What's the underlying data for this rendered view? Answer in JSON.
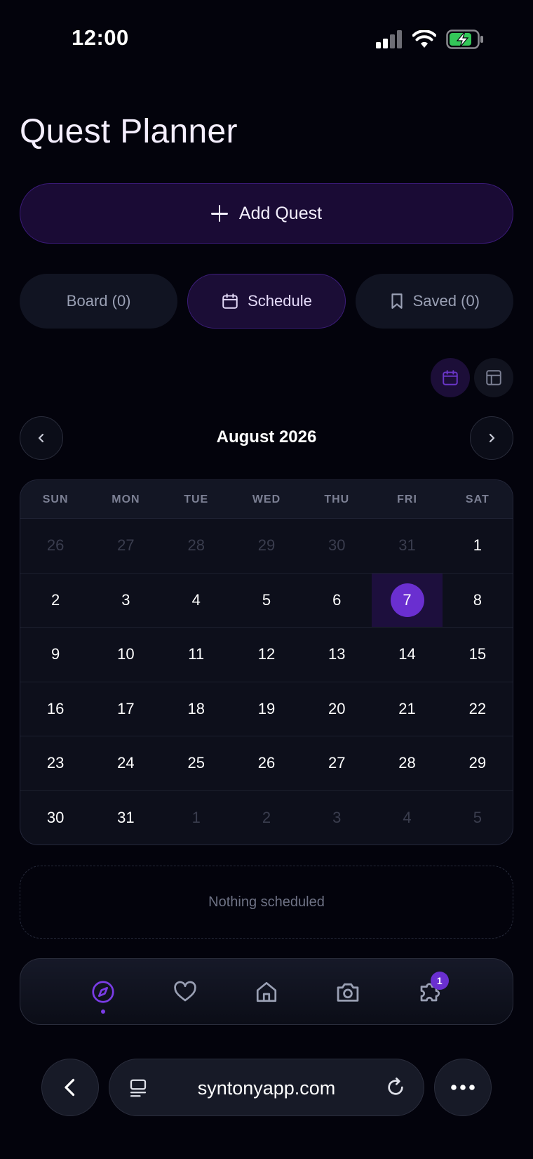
{
  "status_bar": {
    "time": "12:00"
  },
  "header": {
    "title": "Quest Planner"
  },
  "add_quest": {
    "label": "Add Quest"
  },
  "tabs": [
    {
      "label": "Board (0)",
      "icon": "none"
    },
    {
      "label": "Schedule",
      "icon": "calendar-icon",
      "active": true
    },
    {
      "label": "Saved (0)",
      "icon": "bookmark-icon"
    }
  ],
  "view_toggle": {
    "active": "calendar-view",
    "options": [
      "calendar-view",
      "table-view"
    ]
  },
  "calendar": {
    "month_label": "August 2026",
    "weekdays": [
      "SUN",
      "MON",
      "TUE",
      "WED",
      "THU",
      "FRI",
      "SAT"
    ],
    "weeks": [
      [
        "26",
        "27",
        "28",
        "29",
        "30",
        "31",
        "1"
      ],
      [
        "2",
        "3",
        "4",
        "5",
        "6",
        "7",
        "8"
      ],
      [
        "9",
        "10",
        "11",
        "12",
        "13",
        "14",
        "15"
      ],
      [
        "16",
        "17",
        "18",
        "19",
        "20",
        "21",
        "22"
      ],
      [
        "23",
        "24",
        "25",
        "26",
        "27",
        "28",
        "29"
      ],
      [
        "30",
        "31",
        "1",
        "2",
        "3",
        "4",
        "5"
      ]
    ],
    "today": "7"
  },
  "empty_state": {
    "text": "Nothing scheduled"
  },
  "bottom_nav": {
    "items": [
      "compass-icon",
      "heart-icon",
      "home-icon",
      "camera-icon",
      "puzzle-icon"
    ],
    "active": "compass-icon",
    "badge_count": "1"
  },
  "browser": {
    "url": "syntonyapp.com"
  },
  "colors": {
    "accent": "#6a2fd0",
    "background": "#03030c",
    "surface": "#111422"
  }
}
